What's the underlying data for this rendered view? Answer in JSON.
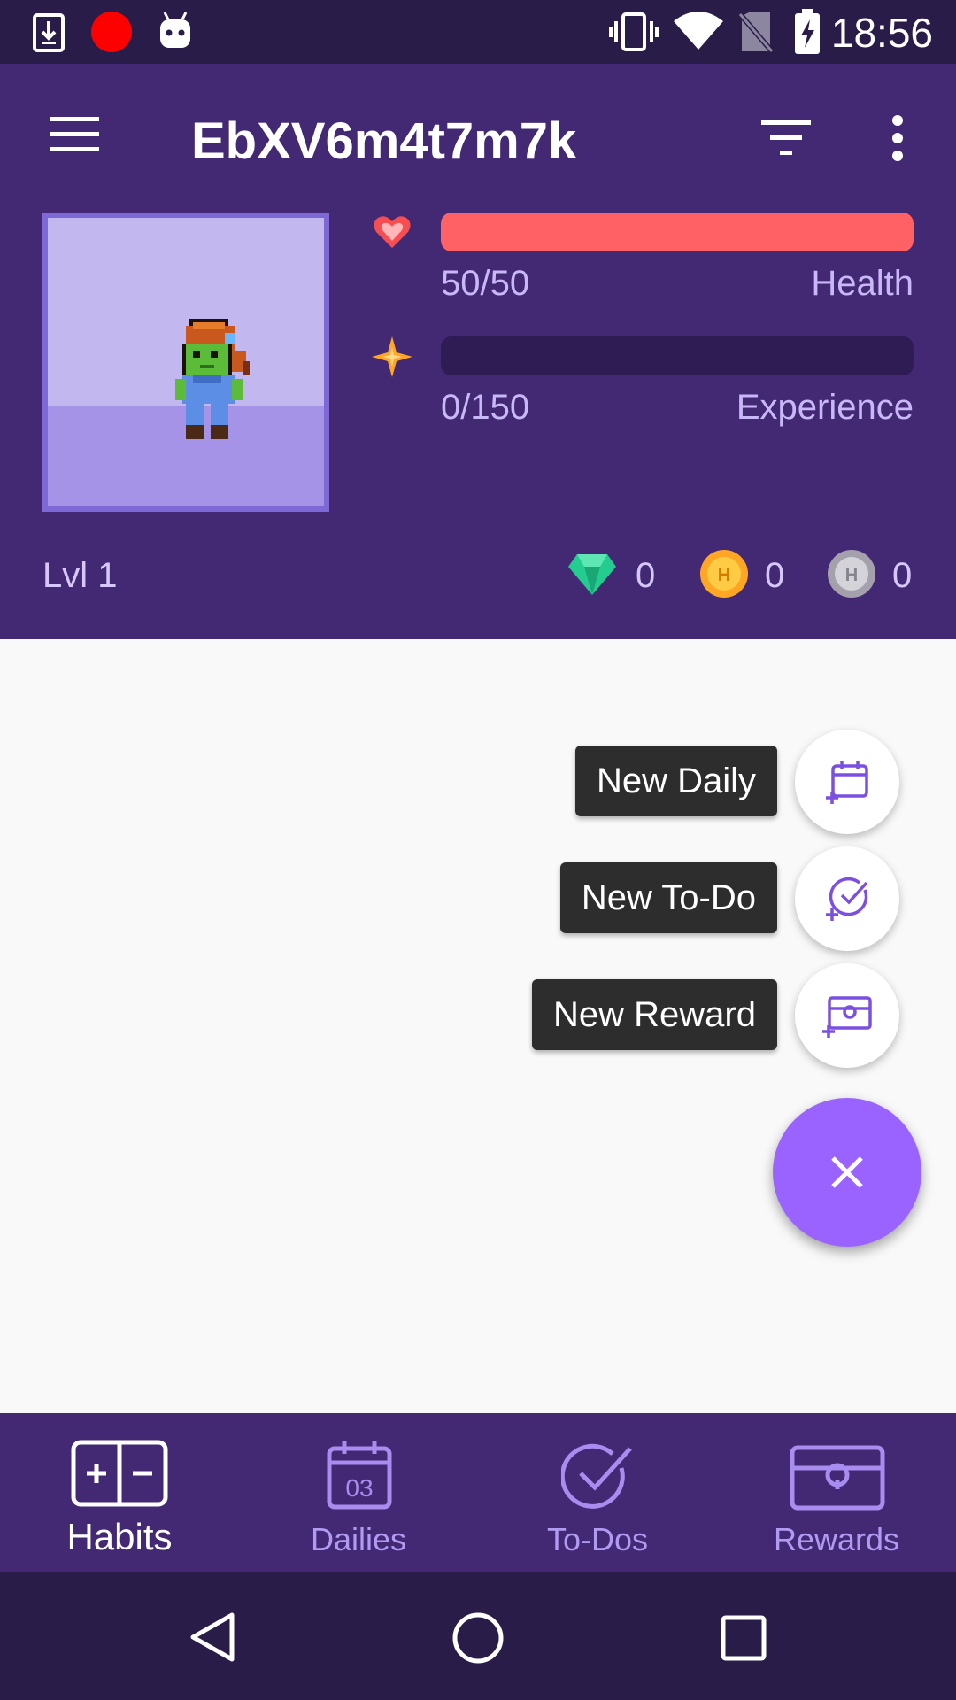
{
  "status_bar": {
    "time": "18:56"
  },
  "header": {
    "title": "EbXV6m4t7m7k",
    "health": {
      "value_text": "50/50",
      "label": "Health",
      "fraction": 1.0,
      "color": "#ff6165"
    },
    "experience": {
      "value_text": "0/150",
      "label": "Experience",
      "fraction": 0.0,
      "color": "#ffbe5d"
    },
    "level": "Lvl 1",
    "gems": "0",
    "gold": "0",
    "hourglasses": "0"
  },
  "fab_menu": {
    "new_daily": "New Daily",
    "new_todo": "New To-Do",
    "new_reward": "New Reward"
  },
  "bottom_nav": {
    "habits": "Habits",
    "dailies": "Dailies",
    "dailies_icon_number": "03",
    "todos": "To-Dos",
    "rewards": "Rewards"
  },
  "colors": {
    "primary": "#432874",
    "accent": "#9a62ff",
    "status_bar": "#2a1c48"
  }
}
